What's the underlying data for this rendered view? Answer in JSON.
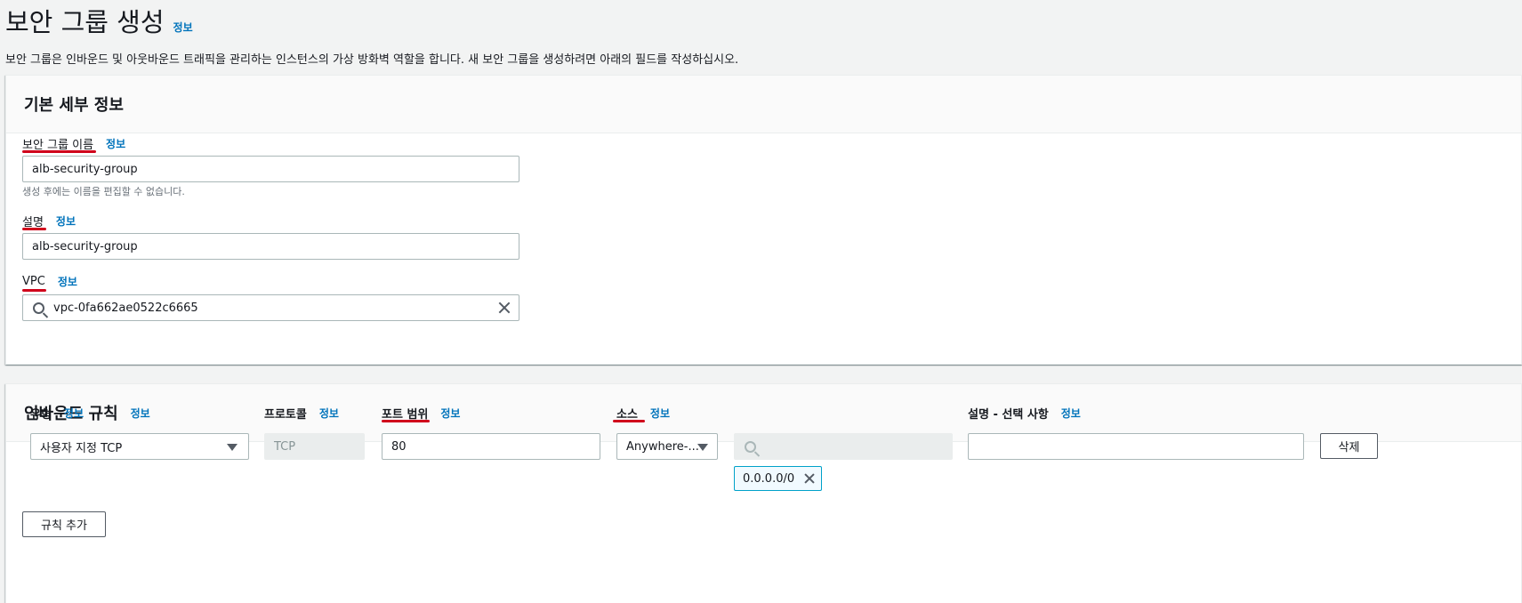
{
  "header": {
    "title": "보안 그룹 생성",
    "info_link": "정보",
    "description": "보안 그룹은 인바운드 및 아웃바운드 트래픽을 관리하는 인스턴스의 가상 방화벽 역할을 합니다. 새 보안 그룹을 생성하려면 아래의 필드를 작성하십시오."
  },
  "basic_details": {
    "title": "기본 세부 정보",
    "name_field": {
      "label": "보안 그룹 이름",
      "info_link": "정보",
      "value": "alb-security-group",
      "hint": "생성 후에는 이름을 편집할 수 없습니다."
    },
    "description_field": {
      "label": "설명",
      "info_link": "정보",
      "value": "alb-security-group"
    },
    "vpc_field": {
      "label": "VPC",
      "info_link": "정보",
      "value": "vpc-0fa662ae0522c6665"
    }
  },
  "inbound_rules": {
    "title": "인바운드 규칙",
    "info_link": "정보",
    "columns": {
      "type": "유형",
      "protocol": "프로토콜",
      "port_range": "포트 범위",
      "source": "소스",
      "description": "설명 - 선택 사항",
      "info_link": "정보"
    },
    "rows": [
      {
        "type": "사용자 지정 TCP",
        "protocol": "TCP",
        "port_range": "80",
        "source_type": "Anywhere-...",
        "source_search": "",
        "source_token": "0.0.0.0/0",
        "description": "",
        "delete_label": "삭제"
      }
    ],
    "add_rule_label": "규칙 추가"
  },
  "annotation_color": "#d0021b",
  "link_color": "#0073bb"
}
